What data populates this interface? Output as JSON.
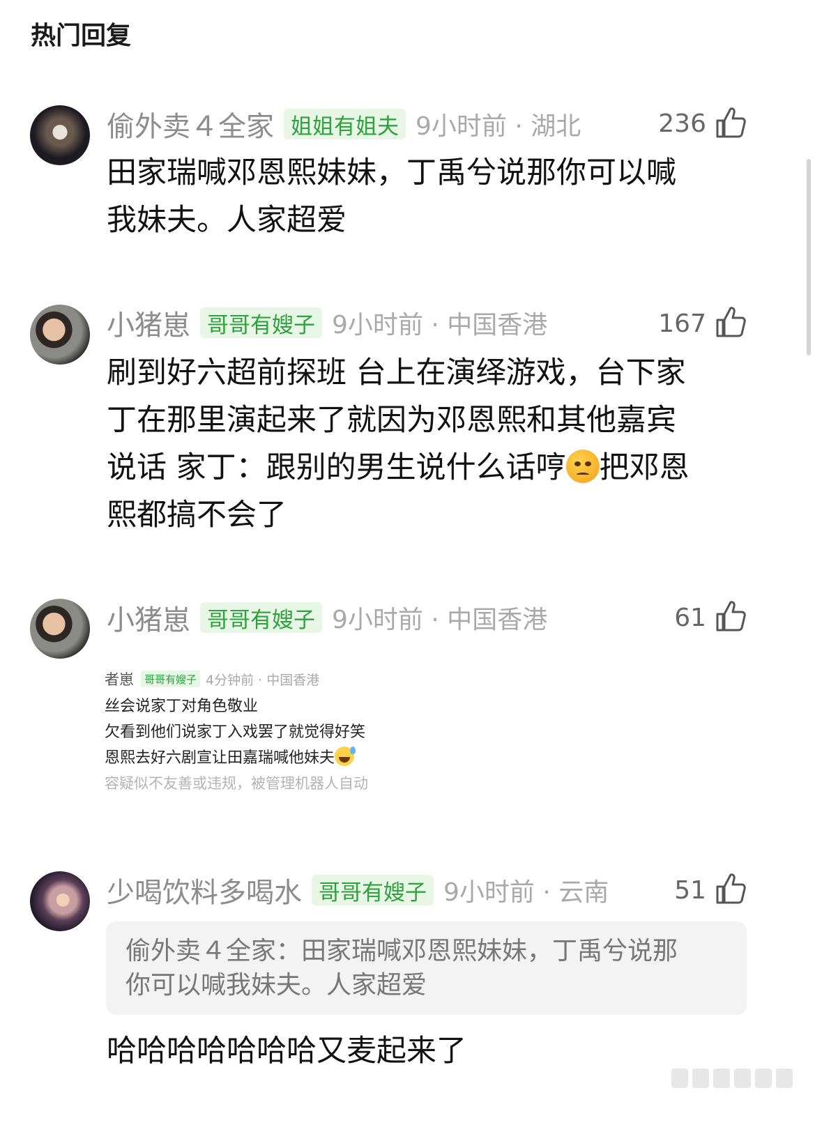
{
  "page": {
    "section_title": "热门回复"
  },
  "comments": [
    {
      "username": "偷外卖４全家",
      "badge": "姐姐有姐夫",
      "meta": "9小时前 · 湖北",
      "likes": "236",
      "lines": [
        "田家瑞喊邓恩熙妹妹，丁禹兮说那你可以喊",
        "我妹夫。人家超爱"
      ]
    },
    {
      "username": "小猪崽",
      "badge": "哥哥有嫂子",
      "meta": "9小时前 · 中国香港",
      "likes": "167",
      "lines": [
        "刷到好六超前探班 台上在演绎游戏，台下家",
        "丁在那里演起来了就因为邓恩熙和其他嘉宾",
        "说话 家丁：跟别的男生说什么话哼",
        "把邓恩",
        "熙都搞不会了"
      ]
    },
    {
      "username": "小猪崽",
      "badge": "哥哥有嫂子",
      "meta": "9小时前 · 中国香港",
      "likes": "61",
      "embedded": {
        "username": "者崽",
        "badge": "哥哥有嫂子",
        "meta": "4分钟前 · 中国香港",
        "lines": [
          "丝会说家丁对角色敬业",
          "欠看到他们说家丁入戏罢了就觉得好笑",
          "恩熙去好六剧宣让田嘉瑞喊他妹夫"
        ],
        "note": "容疑似不友善或违规，被管理机器人自动"
      }
    },
    {
      "username": "少喝饮料多喝水",
      "badge": "哥哥有嫂子",
      "meta": "9小时前 · 云南",
      "likes": "51",
      "quote_lines": [
        "偷外卖４全家：田家瑞喊邓恩熙妹妹，丁禹兮说那",
        "你可以喊我妹夫。人家超爱"
      ],
      "reply": "哈哈哈哈哈哈哈又麦起来了"
    }
  ],
  "icons": {
    "like": "thumbs-up-icon",
    "angry": "angry-face-emoji",
    "sweat": "sweat-smile-emoji"
  },
  "colors": {
    "badge_bg": "#e8f6e6",
    "badge_text": "#2ea23e",
    "meta": "#a9a9a9",
    "username": "#8c8c8c"
  }
}
